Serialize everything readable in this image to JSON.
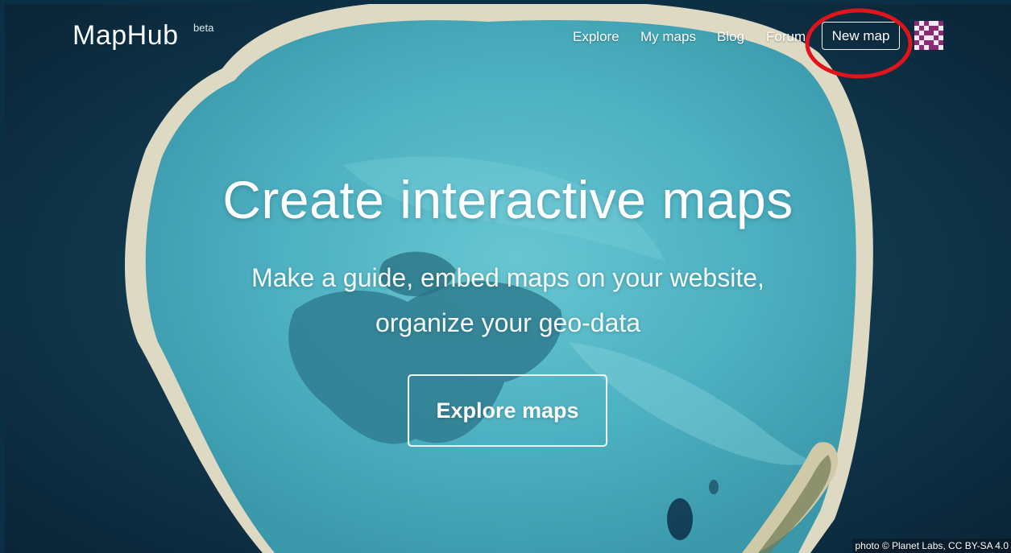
{
  "header": {
    "logo": "MapHub",
    "logo_badge": "beta",
    "nav": [
      {
        "label": "Explore"
      },
      {
        "label": "My maps"
      },
      {
        "label": "Blog"
      },
      {
        "label": "Forum"
      }
    ],
    "new_map_label": "New map",
    "highlight_color": "#e0141b"
  },
  "hero": {
    "title": "Create interactive maps",
    "subtitle_line1": "Make a guide, embed maps on your website,",
    "subtitle_line2": "organize your geo-data",
    "cta_label": "Explore maps"
  },
  "footer": {
    "photo_credit": "photo © Planet Labs, CC BY-SA 4.0"
  },
  "colors": {
    "ocean": "#0b2f45",
    "lagoon": "#4fb3c3",
    "reef": "#e4e0cf"
  }
}
